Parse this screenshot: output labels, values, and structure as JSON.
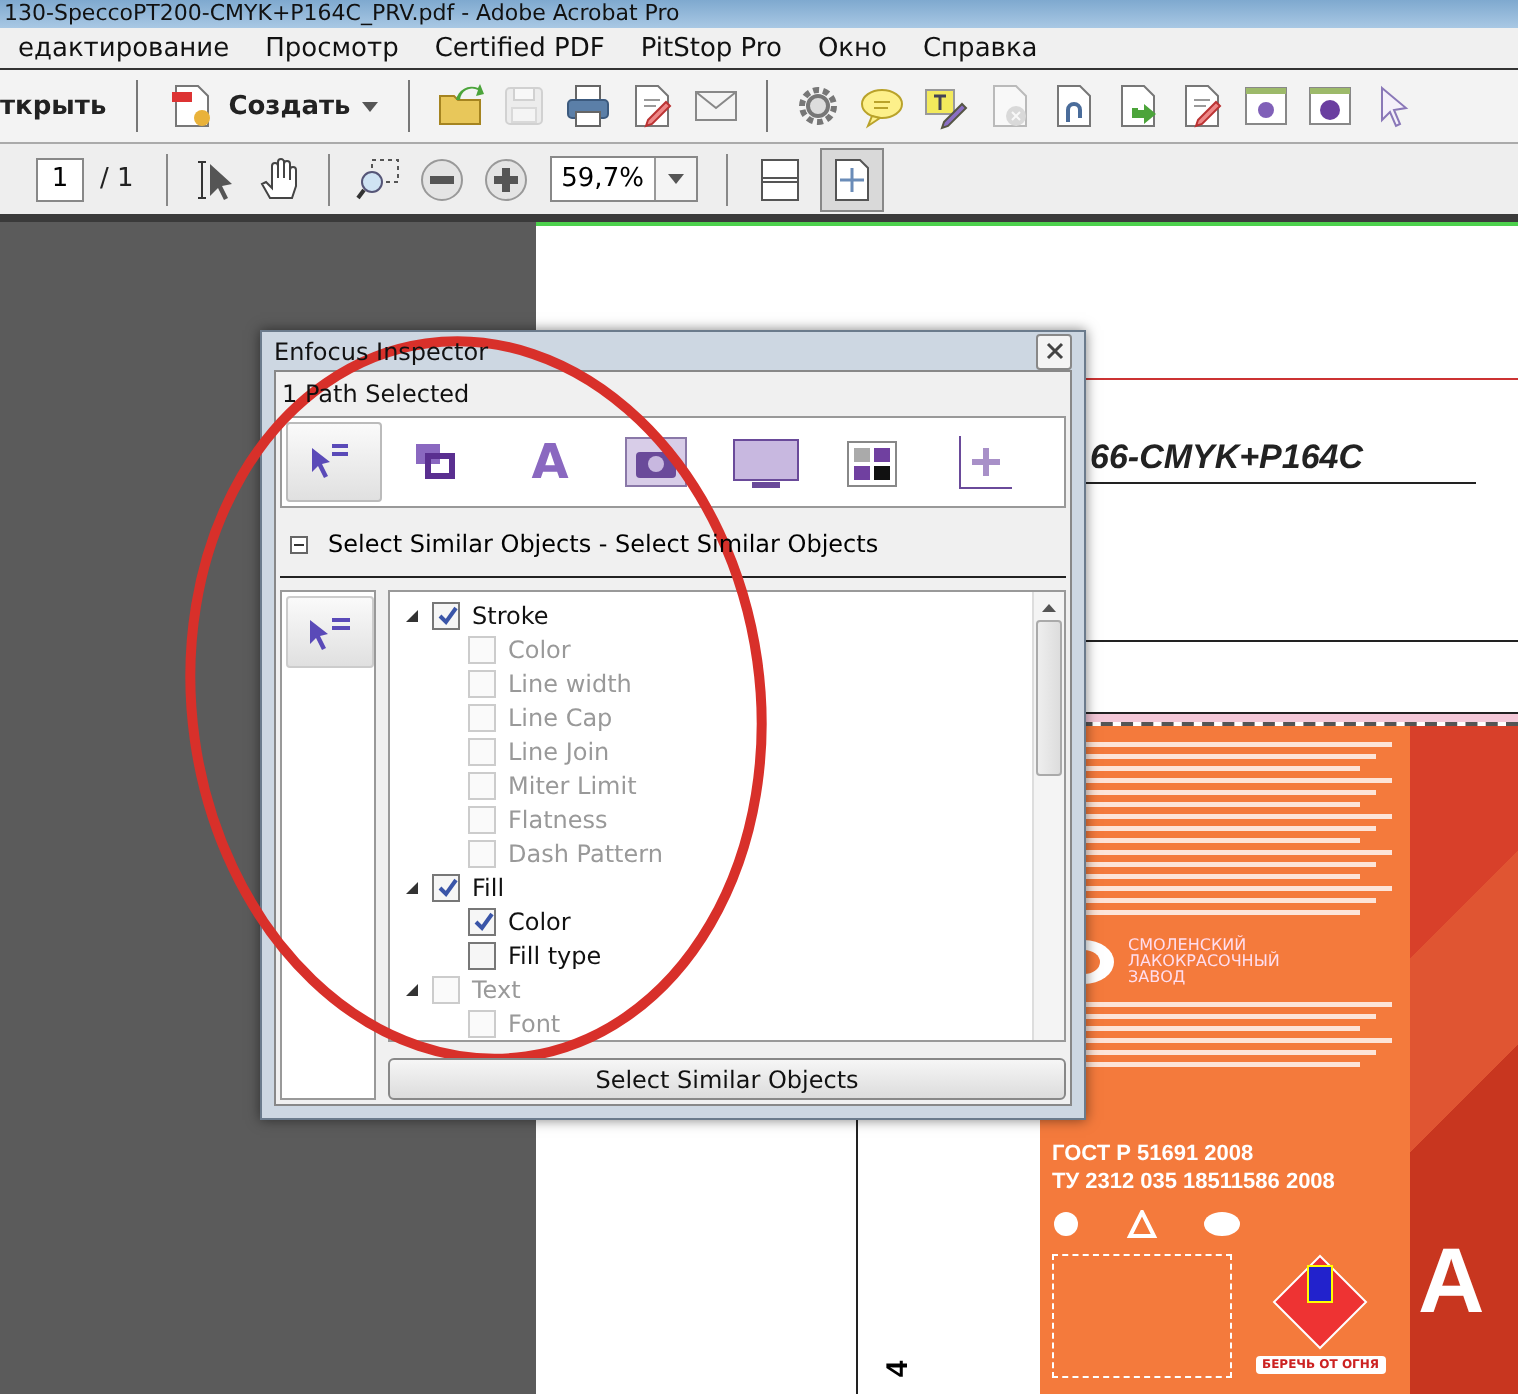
{
  "window": {
    "title": "130-SpeccoPT200-CMYK+P164C_PRV.pdf - Adobe Acrobat Pro"
  },
  "menu": [
    "едактирование",
    "Просмотр",
    "Certified PDF",
    "PitStop Pro",
    "Окно",
    "Справка"
  ],
  "toolbar": {
    "open_label": "ткрыть",
    "create_label": "Создать",
    "tools": [
      {
        "kind": "open-folder",
        "disabled": false
      },
      {
        "kind": "save",
        "disabled": true
      },
      {
        "kind": "print",
        "disabled": false
      },
      {
        "kind": "doc-edit",
        "disabled": false
      },
      {
        "kind": "mail",
        "disabled": false
      },
      {
        "kind": "gear",
        "disabled": false
      },
      {
        "kind": "comment",
        "disabled": false
      },
      {
        "kind": "text-edit",
        "disabled": false
      },
      {
        "kind": "doc-remove",
        "disabled": true
      },
      {
        "kind": "doc-link",
        "disabled": false
      },
      {
        "kind": "doc-export",
        "disabled": false
      },
      {
        "kind": "doc-edit",
        "disabled": false
      },
      {
        "kind": "panel-gear",
        "disabled": false
      },
      {
        "kind": "panel-globe",
        "disabled": false
      },
      {
        "kind": "pointer",
        "disabled": false
      }
    ]
  },
  "navigation": {
    "page": "1",
    "total": "/ 1",
    "zoom": "59,7%",
    "view_modes": [
      {
        "kind": "fit-page",
        "selected": false
      },
      {
        "kind": "fit-visible",
        "selected": true
      }
    ]
  },
  "document": {
    "heading": "66-CMYK+P164C",
    "page_number": "4",
    "maker": [
      "СМОЛЕНСКИЙ",
      "ЛАКОКРАСОЧНЫЙ",
      "ЗАВОД"
    ],
    "standards": [
      "ГОСТ Р 51691 2008",
      "ТУ 2312 035 18511586 2008"
    ],
    "warning": "БЕРЕЧЬ ОТ ОГНЯ",
    "big_letter": "А"
  },
  "inspector": {
    "title": "Enfocus Inspector",
    "status": "1 Path Selected",
    "categories": [
      {
        "kind": "select-similar",
        "selected": true
      },
      {
        "kind": "layers",
        "selected": false
      },
      {
        "kind": "text",
        "glyph": "A",
        "selected": false
      },
      {
        "kind": "image",
        "selected": false
      },
      {
        "kind": "display",
        "selected": false
      },
      {
        "kind": "color-grid",
        "selected": false
      },
      {
        "kind": "transform",
        "selected": false
      }
    ],
    "section": {
      "label": "Select Similar Objects - Select Similar Objects",
      "expanded": true
    },
    "tree": [
      {
        "label": "Stroke",
        "checked": true,
        "disabled": false,
        "expanded": true,
        "children": [
          {
            "label": "Color",
            "checked": false,
            "disabled": true
          },
          {
            "label": "Line width",
            "checked": false,
            "disabled": true
          },
          {
            "label": "Line Cap",
            "checked": false,
            "disabled": true
          },
          {
            "label": "Line Join",
            "checked": false,
            "disabled": true
          },
          {
            "label": "Miter Limit",
            "checked": false,
            "disabled": true
          },
          {
            "label": "Flatness",
            "checked": false,
            "disabled": true
          },
          {
            "label": "Dash Pattern",
            "checked": false,
            "disabled": true
          }
        ]
      },
      {
        "label": "Fill",
        "checked": true,
        "disabled": false,
        "expanded": true,
        "children": [
          {
            "label": "Color",
            "checked": true,
            "disabled": false
          },
          {
            "label": "Fill type",
            "checked": false,
            "disabled": false
          }
        ]
      },
      {
        "label": "Text",
        "checked": false,
        "disabled": true,
        "expanded": true,
        "children": [
          {
            "label": "Font",
            "checked": false,
            "disabled": true
          }
        ]
      }
    ],
    "action_button": "Select Similar Objects"
  },
  "annotation": {
    "kind": "ellipse"
  }
}
